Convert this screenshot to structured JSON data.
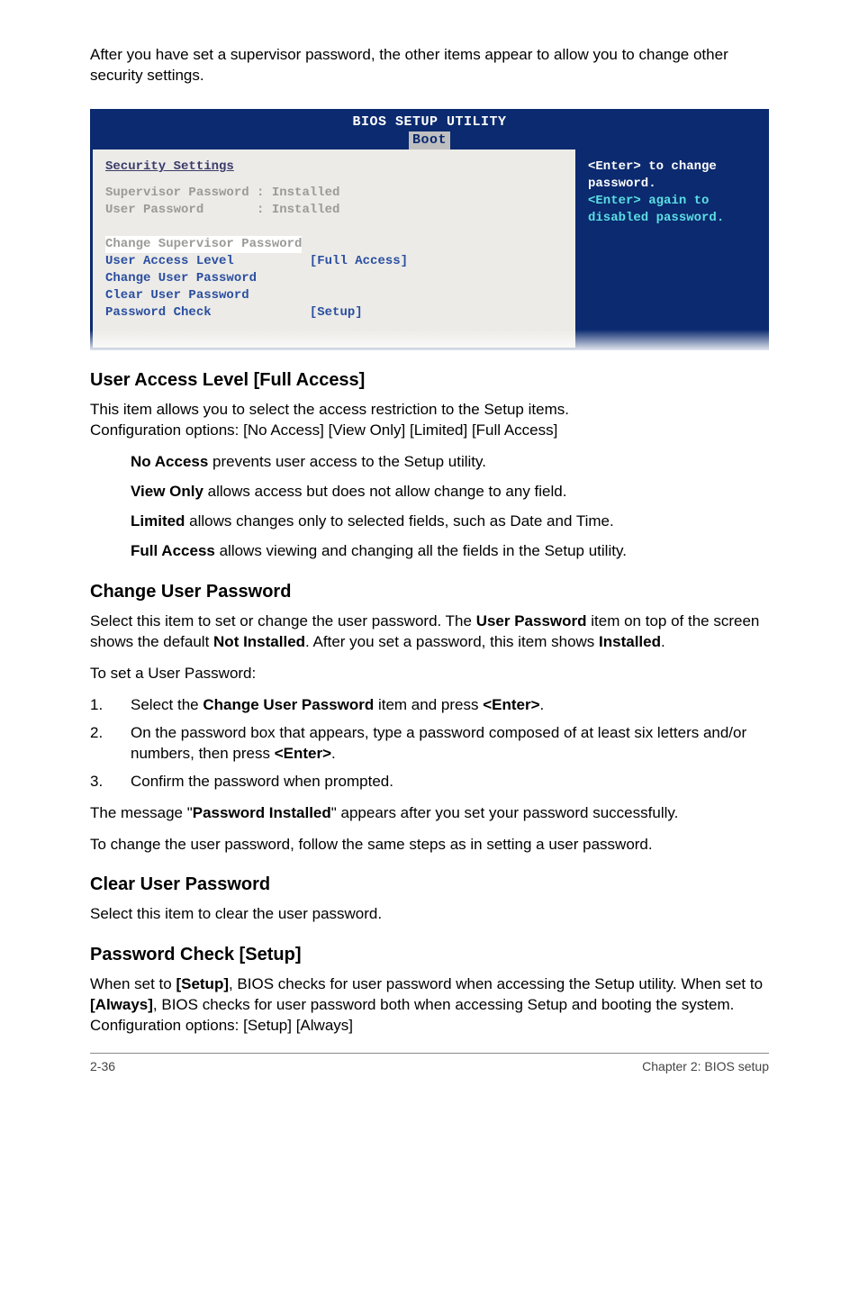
{
  "intro": "After you have set a supervisor password, the other items appear to allow you to change other security settings.",
  "bios": {
    "title": "BIOS SETUP UTILITY",
    "tab": "Boot",
    "heading": "Security Settings",
    "sup_label": "Supervisor Password ",
    "sup_val": ": Installed",
    "user_label": "User Password       ",
    "user_val": ": Installed",
    "change_sup": "Change Supervisor Password",
    "access_label": "User Access Level          ",
    "access_val": "[Full Access]",
    "change_user": "Change User Password",
    "clear_user": "Clear User Password",
    "pwd_check_label": "Password Check             ",
    "pwd_check_val": "[Setup]",
    "help1": "<Enter> to change",
    "help2": "password.",
    "help3": "<Enter> again to",
    "help4": "disabled password."
  },
  "ual": {
    "title": "User Access Level [Full Access]",
    "p1": "This item allows you to select the access restriction to the Setup items.",
    "p2": "Configuration options: [No Access] [View Only] [Limited] [Full Access]",
    "no_access_b": "No Access",
    "no_access_t": " prevents user access to the Setup utility.",
    "view_only_b": "View Only",
    "view_only_t": " allows access but does not allow change to any field.",
    "limited_b": "Limited",
    "limited_t": " allows changes only to selected fields, such as Date and Time.",
    "full_access_b": "Full Access",
    "full_access_t": " allows viewing and changing all the fields in the Setup utility."
  },
  "cup": {
    "title": "Change User Password",
    "p1a": "Select this item to set or change the user password. The ",
    "p1b": "User Password",
    "p1c": " item on top of the screen shows the default ",
    "p1d": "Not Installed",
    "p1e": ". After you set a password, this item shows ",
    "p1f": "Installed",
    "p1g": ".",
    "p2": "To set a User Password:",
    "li1a": "Select the ",
    "li1b": "Change User Password",
    "li1c": " item and press ",
    "li1d": "<Enter>",
    "li1e": ".",
    "li2a": "On the password box that appears, type a password composed of at least six letters and/or numbers, then press ",
    "li2b": "<Enter>",
    "li2c": ".",
    "li3": "Confirm the password when prompted.",
    "p3a": "The message \"",
    "p3b": "Password Installed",
    "p3c": "\" appears after you set your password successfully.",
    "p4": "To change the user password, follow the same steps as in setting a user password."
  },
  "clear": {
    "title": "Clear User Password",
    "p1": "Select this item to clear the user password."
  },
  "pwdcheck": {
    "title": "Password Check [Setup]",
    "p1a": "When set to ",
    "p1b": "[Setup]",
    "p1c": ", BIOS checks for user password when accessing the Setup utility. When set to ",
    "p1d": "[Always]",
    "p1e": ", BIOS checks for user password both when accessing Setup and booting the system. Configuration options: [Setup] [Always]"
  },
  "footer": {
    "page": "2-36",
    "chapter": "Chapter 2: BIOS setup"
  }
}
